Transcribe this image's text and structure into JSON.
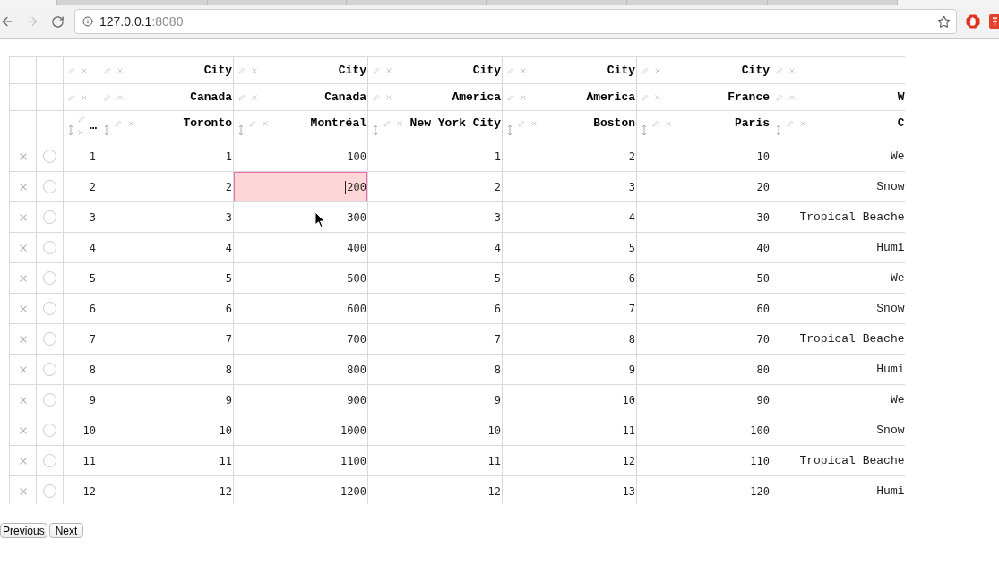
{
  "browser": {
    "back": {
      "disabled": false
    },
    "forward": {
      "disabled": true
    },
    "address": {
      "host": "127.0.0.1",
      "port": ":8080"
    },
    "bookmarked": false
  },
  "table": {
    "columns": [
      {
        "kind": "index",
        "header_3": "…"
      },
      {
        "kind": "number",
        "header_1": "City",
        "header_2": "Canada",
        "header_3": "Toronto"
      },
      {
        "kind": "number",
        "header_1": "City",
        "header_2": "Canada",
        "header_3": "Montréal"
      },
      {
        "kind": "number",
        "header_1": "City",
        "header_2": "America",
        "header_3": "New York City"
      },
      {
        "kind": "number",
        "header_1": "City",
        "header_2": "America",
        "header_3": "Boston"
      },
      {
        "kind": "number",
        "header_1": "City",
        "header_2": "France",
        "header_3": "Paris"
      },
      {
        "kind": "text",
        "header_2": "W",
        "header_3": "C"
      }
    ],
    "rows": [
      {
        "selected": false,
        "cells": [
          {
            "text": "1",
            "active": false
          },
          {
            "text": "1",
            "active": false
          },
          {
            "text": "100",
            "active": false
          },
          {
            "text": "1",
            "active": false
          },
          {
            "text": "2",
            "active": false
          },
          {
            "text": "10",
            "active": false
          },
          {
            "text": "We",
            "active": false
          }
        ]
      },
      {
        "selected": false,
        "cells": [
          {
            "text": "2",
            "active": false
          },
          {
            "text": "2",
            "active": false
          },
          {
            "text": "200",
            "active": true
          },
          {
            "text": "2",
            "active": false
          },
          {
            "text": "3",
            "active": false
          },
          {
            "text": "20",
            "active": false
          },
          {
            "text": "Snow",
            "active": false
          }
        ]
      },
      {
        "selected": false,
        "cells": [
          {
            "text": "3",
            "active": false
          },
          {
            "text": "3",
            "active": false
          },
          {
            "text": "300",
            "active": false
          },
          {
            "text": "3",
            "active": false
          },
          {
            "text": "4",
            "active": false
          },
          {
            "text": "30",
            "active": false
          },
          {
            "text": "Tropical Beache",
            "active": false
          }
        ]
      },
      {
        "selected": false,
        "cells": [
          {
            "text": "4",
            "active": false
          },
          {
            "text": "4",
            "active": false
          },
          {
            "text": "400",
            "active": false
          },
          {
            "text": "4",
            "active": false
          },
          {
            "text": "5",
            "active": false
          },
          {
            "text": "40",
            "active": false
          },
          {
            "text": "Humi",
            "active": false
          }
        ]
      },
      {
        "selected": false,
        "cells": [
          {
            "text": "5",
            "active": false
          },
          {
            "text": "5",
            "active": false
          },
          {
            "text": "500",
            "active": false
          },
          {
            "text": "5",
            "active": false
          },
          {
            "text": "6",
            "active": false
          },
          {
            "text": "50",
            "active": false
          },
          {
            "text": "We",
            "active": false
          }
        ]
      },
      {
        "selected": false,
        "cells": [
          {
            "text": "6",
            "active": false
          },
          {
            "text": "6",
            "active": false
          },
          {
            "text": "600",
            "active": false
          },
          {
            "text": "6",
            "active": false
          },
          {
            "text": "7",
            "active": false
          },
          {
            "text": "60",
            "active": false
          },
          {
            "text": "Snow",
            "active": false
          }
        ]
      },
      {
        "selected": false,
        "cells": [
          {
            "text": "7",
            "active": false
          },
          {
            "text": "7",
            "active": false
          },
          {
            "text": "700",
            "active": false
          },
          {
            "text": "7",
            "active": false
          },
          {
            "text": "8",
            "active": false
          },
          {
            "text": "70",
            "active": false
          },
          {
            "text": "Tropical Beache",
            "active": false
          }
        ]
      },
      {
        "selected": false,
        "cells": [
          {
            "text": "8",
            "active": false
          },
          {
            "text": "8",
            "active": false
          },
          {
            "text": "800",
            "active": false
          },
          {
            "text": "8",
            "active": false
          },
          {
            "text": "9",
            "active": false
          },
          {
            "text": "80",
            "active": false
          },
          {
            "text": "Humi",
            "active": false
          }
        ]
      },
      {
        "selected": false,
        "cells": [
          {
            "text": "9",
            "active": false
          },
          {
            "text": "9",
            "active": false
          },
          {
            "text": "900",
            "active": false
          },
          {
            "text": "9",
            "active": false
          },
          {
            "text": "10",
            "active": false
          },
          {
            "text": "90",
            "active": false
          },
          {
            "text": "We",
            "active": false
          }
        ]
      },
      {
        "selected": false,
        "cells": [
          {
            "text": "10",
            "active": false
          },
          {
            "text": "10",
            "active": false
          },
          {
            "text": "1000",
            "active": false
          },
          {
            "text": "10",
            "active": false
          },
          {
            "text": "11",
            "active": false
          },
          {
            "text": "100",
            "active": false
          },
          {
            "text": "Snow",
            "active": false
          }
        ]
      },
      {
        "selected": false,
        "cells": [
          {
            "text": "11",
            "active": false
          },
          {
            "text": "11",
            "active": false
          },
          {
            "text": "1100",
            "active": false
          },
          {
            "text": "11",
            "active": false
          },
          {
            "text": "12",
            "active": false
          },
          {
            "text": "110",
            "active": false
          },
          {
            "text": "Tropical Beache",
            "active": false
          }
        ]
      },
      {
        "selected": false,
        "cells": [
          {
            "text": "12",
            "active": false
          },
          {
            "text": "12",
            "active": false
          },
          {
            "text": "1200",
            "active": false
          },
          {
            "text": "12",
            "active": false
          },
          {
            "text": "13",
            "active": false
          },
          {
            "text": "120",
            "active": false
          },
          {
            "text": "Humi",
            "active": false
          }
        ]
      }
    ]
  },
  "pagination": {
    "buttons": [
      "Previous",
      "Next"
    ]
  }
}
